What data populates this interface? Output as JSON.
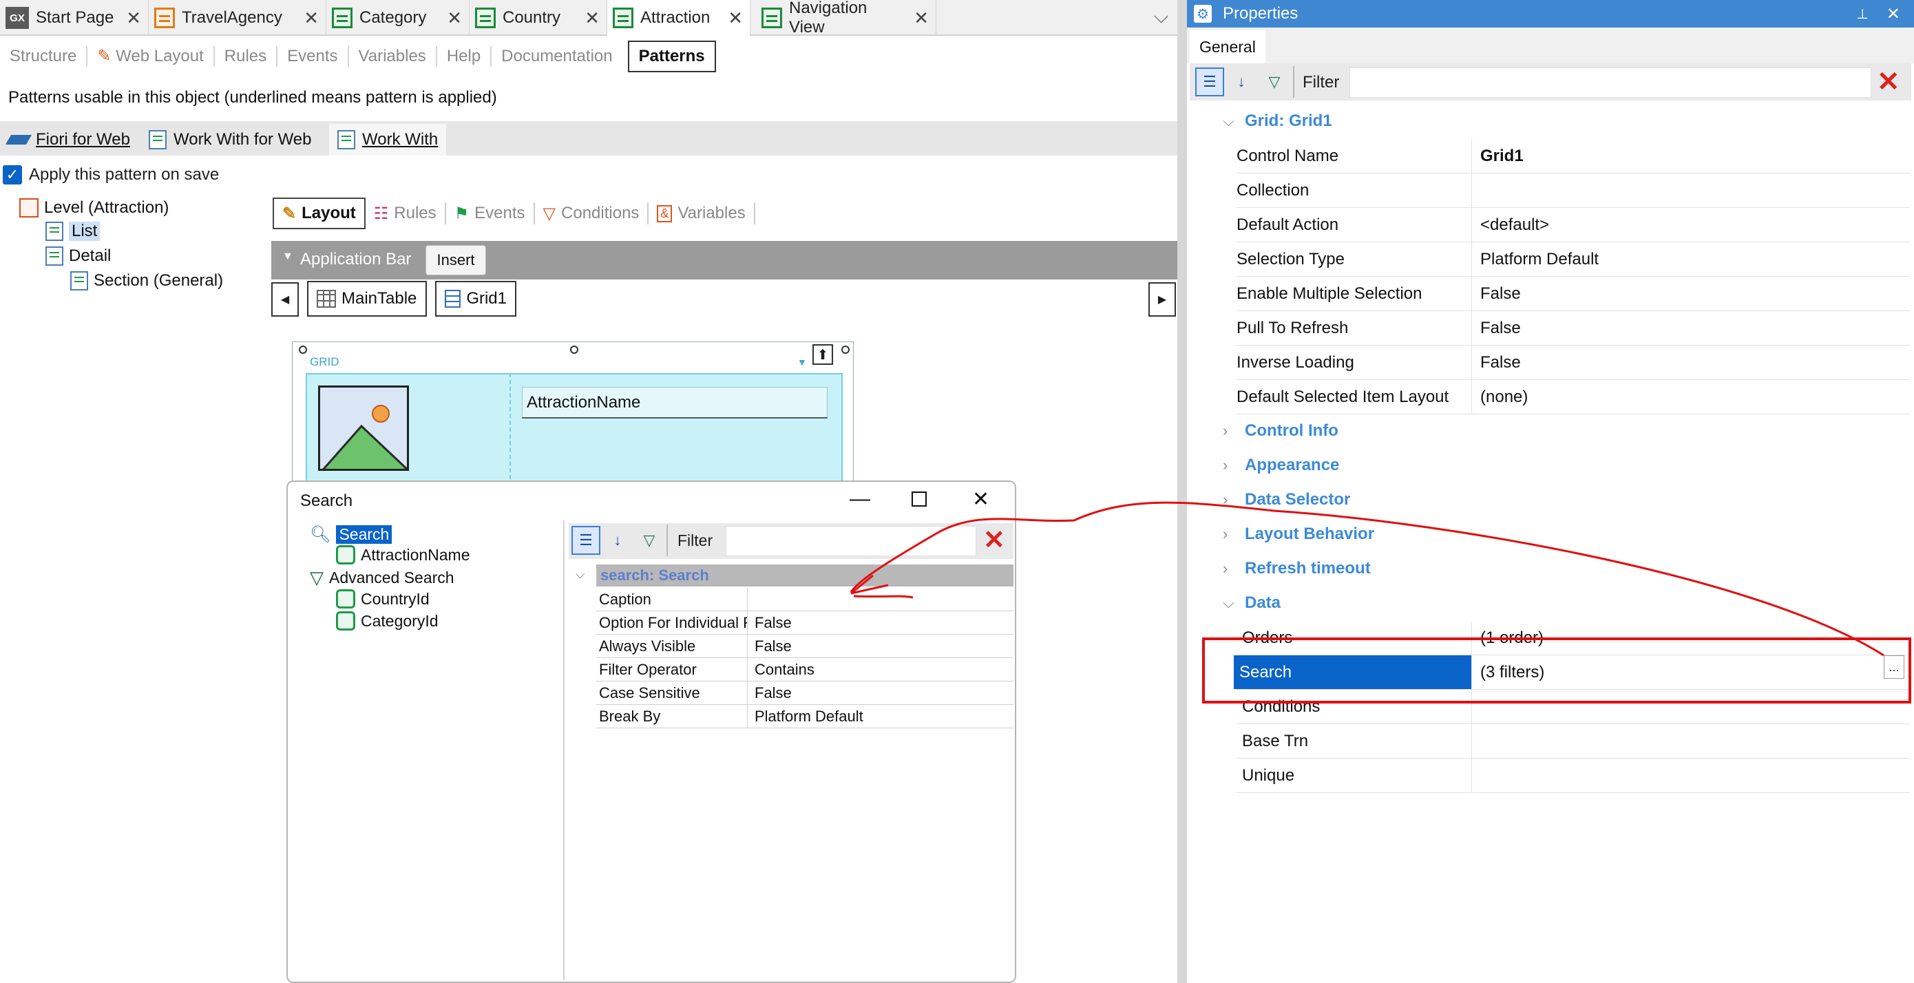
{
  "tabs": [
    {
      "label": "Start Page",
      "icon": "gx-icon"
    },
    {
      "label": "TravelAgency",
      "icon": "table-icon"
    },
    {
      "label": "Category",
      "icon": "table-icon"
    },
    {
      "label": "Country",
      "icon": "table-icon"
    },
    {
      "label": "Attraction",
      "icon": "table-icon",
      "active": true
    },
    {
      "label": "Navigation View",
      "icon": "table-icon"
    }
  ],
  "gx_badge": "GX",
  "subtabs": [
    "Structure",
    "Web Layout",
    "Rules",
    "Events",
    "Variables",
    "Help",
    "Documentation",
    "Patterns"
  ],
  "patterns_heading": "Patterns usable in this object (underlined means pattern is applied)",
  "pattern_tabs": [
    "Fiori for Web",
    "Work With for Web",
    "Work With"
  ],
  "apply_on_save": "Apply this pattern on save",
  "tree": {
    "level": "Level (Attraction)",
    "list": "List",
    "detail": "Detail",
    "section": "Section (General)"
  },
  "layout_tabs": [
    "Layout",
    "Rules",
    "Events",
    "Conditions",
    "Variables"
  ],
  "application_bar": "Application Bar",
  "insert_button": "Insert",
  "breadcrumbs": [
    "MainTable",
    "Grid1"
  ],
  "grid": {
    "label": "GRID",
    "field": "AttractionName"
  },
  "search_dialog": {
    "title": "Search",
    "tree": {
      "search": "Search",
      "attraction_name": "AttractionName",
      "advanced_search": "Advanced Search",
      "country_id": "CountryId",
      "category_id": "CategoryId"
    },
    "filter_label": "Filter",
    "section": "search: Search",
    "properties": [
      {
        "key": "Caption",
        "value": ""
      },
      {
        "key": "Option For Individual F",
        "value": "False"
      },
      {
        "key": "Always Visible",
        "value": "False"
      },
      {
        "key": "Filter Operator",
        "value": "Contains"
      },
      {
        "key": "Case Sensitive",
        "value": "False"
      },
      {
        "key": "Break By",
        "value": "Platform Default"
      }
    ]
  },
  "properties": {
    "title": "Properties",
    "tab": "General",
    "filter_label": "Filter",
    "group": "Grid: Grid1",
    "rows": [
      {
        "key": "Control Name",
        "value": "Grid1"
      },
      {
        "key": "Collection",
        "value": ""
      },
      {
        "key": "Default Action",
        "value": "<default>"
      },
      {
        "key": "Selection Type",
        "value": "Platform Default"
      },
      {
        "key": "Enable Multiple Selection",
        "value": "False"
      },
      {
        "key": "Pull To Refresh",
        "value": "False"
      },
      {
        "key": "Inverse Loading",
        "value": "False"
      },
      {
        "key": "Default Selected Item Layout",
        "value": "(none)"
      }
    ],
    "collapsed_groups": [
      "Control Info",
      "Appearance",
      "Data Selector",
      "Layout Behavior",
      "Refresh timeout"
    ],
    "data_group": "Data",
    "data_rows": [
      {
        "key": "Orders",
        "value": "(1 order)"
      },
      {
        "key": "Search",
        "value": "(3 filters)"
      },
      {
        "key": "Conditions",
        "value": ""
      },
      {
        "key": "Base Trn",
        "value": ""
      },
      {
        "key": "Unique",
        "value": ""
      }
    ],
    "ellipsis": "..."
  },
  "colors": {
    "accent": "#0a63c9",
    "annotation": "#e01010",
    "props_header": "#3f87d0",
    "group_text": "#3c8ad6"
  }
}
